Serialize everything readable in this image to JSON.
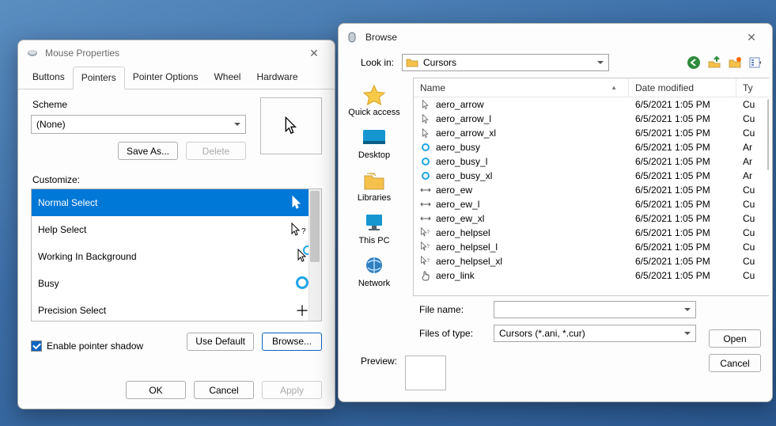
{
  "mouse_properties": {
    "title": "Mouse Properties",
    "tabs": [
      "Buttons",
      "Pointers",
      "Pointer Options",
      "Wheel",
      "Hardware"
    ],
    "active_tab_index": 1,
    "scheme_label": "Scheme",
    "scheme_value": "(None)",
    "save_as_label": "Save As...",
    "delete_label": "Delete",
    "customize_label": "Customize:",
    "cursors": [
      {
        "label": "Normal Select",
        "glyph": "arrow-white",
        "selected": true
      },
      {
        "label": "Help Select",
        "glyph": "arrow-help",
        "selected": false
      },
      {
        "label": "Working In Background",
        "glyph": "arrow-ring",
        "selected": false
      },
      {
        "label": "Busy",
        "glyph": "ring",
        "selected": false
      },
      {
        "label": "Precision Select",
        "glyph": "plus",
        "selected": false
      }
    ],
    "enable_shadow_label": "Enable pointer shadow",
    "enable_shadow_checked": true,
    "use_default_label": "Use Default",
    "browse_label": "Browse...",
    "ok_label": "OK",
    "cancel_label": "Cancel",
    "apply_label": "Apply"
  },
  "browse": {
    "title": "Browse",
    "lookin_label": "Look in:",
    "lookin_value": "Cursors",
    "toolbar_icons": [
      "back-icon",
      "up-icon",
      "new-folder-icon",
      "views-icon"
    ],
    "places": [
      "Quick access",
      "Desktop",
      "Libraries",
      "This PC",
      "Network"
    ],
    "columns": [
      "Name",
      "Date modified",
      "Ty"
    ],
    "files": [
      {
        "name": "aero_arrow",
        "date": "6/5/2021 1:05 PM",
        "type_abbrev": "Cu",
        "icon": "arrow"
      },
      {
        "name": "aero_arrow_l",
        "date": "6/5/2021 1:05 PM",
        "type_abbrev": "Cu",
        "icon": "arrow"
      },
      {
        "name": "aero_arrow_xl",
        "date": "6/5/2021 1:05 PM",
        "type_abbrev": "Cu",
        "icon": "arrow"
      },
      {
        "name": "aero_busy",
        "date": "6/5/2021 1:05 PM",
        "type_abbrev": "Ar",
        "icon": "ring"
      },
      {
        "name": "aero_busy_l",
        "date": "6/5/2021 1:05 PM",
        "type_abbrev": "Ar",
        "icon": "ring"
      },
      {
        "name": "aero_busy_xl",
        "date": "6/5/2021 1:05 PM",
        "type_abbrev": "Ar",
        "icon": "ring"
      },
      {
        "name": "aero_ew",
        "date": "6/5/2021 1:05 PM",
        "type_abbrev": "Cu",
        "icon": "ew"
      },
      {
        "name": "aero_ew_l",
        "date": "6/5/2021 1:05 PM",
        "type_abbrev": "Cu",
        "icon": "ew"
      },
      {
        "name": "aero_ew_xl",
        "date": "6/5/2021 1:05 PM",
        "type_abbrev": "Cu",
        "icon": "ew"
      },
      {
        "name": "aero_helpsel",
        "date": "6/5/2021 1:05 PM",
        "type_abbrev": "Cu",
        "icon": "help"
      },
      {
        "name": "aero_helpsel_l",
        "date": "6/5/2021 1:05 PM",
        "type_abbrev": "Cu",
        "icon": "help"
      },
      {
        "name": "aero_helpsel_xl",
        "date": "6/5/2021 1:05 PM",
        "type_abbrev": "Cu",
        "icon": "help"
      },
      {
        "name": "aero_link",
        "date": "6/5/2021 1:05 PM",
        "type_abbrev": "Cu",
        "icon": "hand"
      }
    ],
    "filename_label": "File name:",
    "filename_value": "",
    "filetype_label": "Files of type:",
    "filetype_value": "Cursors (*.ani, *.cur)",
    "open_label": "Open",
    "cancel_label": "Cancel",
    "preview_label": "Preview:"
  }
}
